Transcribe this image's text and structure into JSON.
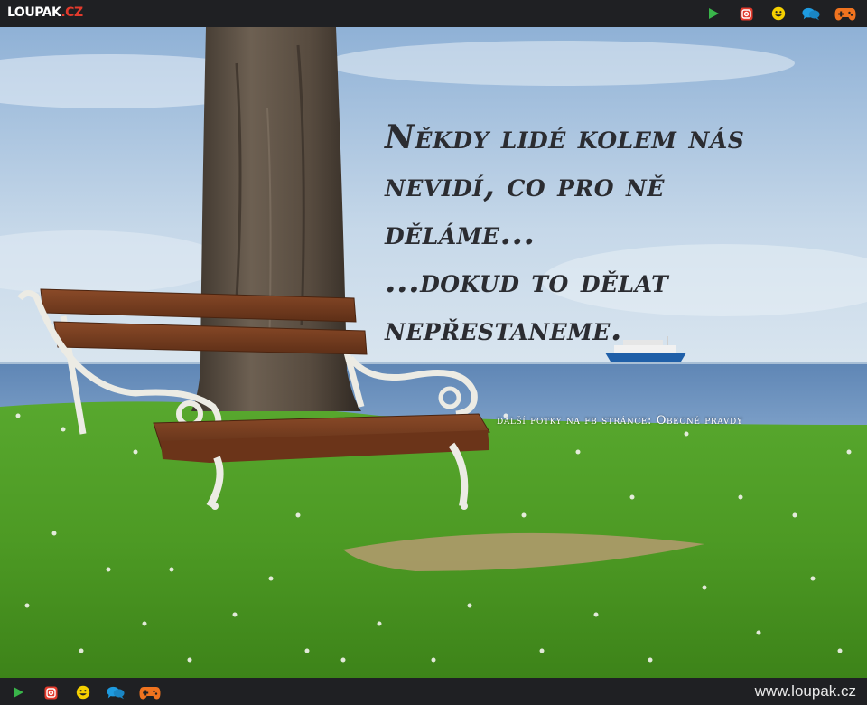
{
  "header": {
    "logo_main": "LOUPAK",
    "logo_tld": ".CZ",
    "icons": [
      "play-icon",
      "instagram-icon",
      "smiley-icon",
      "chat-icon",
      "gamepad-icon"
    ]
  },
  "meme": {
    "quote_lines": [
      "Někdy lidé kolem nás",
      "nevidí, co pro ně",
      "děláme...",
      "...dokud to dělat",
      "nepřestaneme."
    ],
    "credit": "další fotky na fb stránce: Obecné pravdy"
  },
  "footer": {
    "site_url": "www.loupak.cz",
    "icons": [
      "play-icon",
      "instagram-icon",
      "smiley-icon",
      "chat-icon",
      "gamepad-icon"
    ]
  },
  "colors": {
    "bar_bg": "#1f2023",
    "accent_red": "#e23a2c",
    "play_green": "#39b54a",
    "smiley_yellow": "#f5d000",
    "chat_blue": "#1e9be0",
    "gamepad_orange": "#f0731f",
    "quote_text": "#2b2c31"
  }
}
